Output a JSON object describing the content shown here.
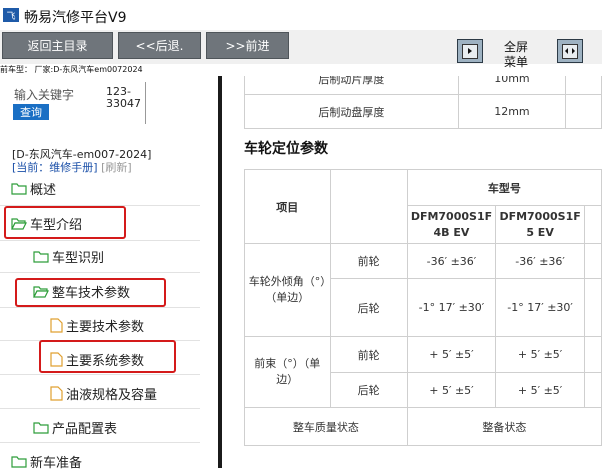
{
  "window": {
    "title": "畅易汽修平台V9"
  },
  "toolbar": {
    "back_main": "返回主目录",
    "back": "<<后退.",
    "forward": ">>前进",
    "fullscreen_line1": "全屏",
    "fullscreen_line2": "菜单"
  },
  "status": {
    "text": "前车型：  厂家:D-东风汽车em0072024"
  },
  "sidebar": {
    "keyword_label": "输入关键字",
    "keyword_value_line1": "123-",
    "keyword_value_line2": "33047",
    "query_button": "查询",
    "doc_code": "[D-东风汽车-em007-2024]",
    "current_label": "[当前：维修手册]",
    "refresh_label": "[刷新]",
    "tree": [
      {
        "label": "概述"
      },
      {
        "label": "车型介绍"
      },
      {
        "label": "车型识别"
      },
      {
        "label": "整车技术参数"
      },
      {
        "label": "主要技术参数"
      },
      {
        "label": "主要系统参数"
      },
      {
        "label": "油液规格及容量"
      },
      {
        "label": "产品配置表"
      },
      {
        "label": "新车准备"
      }
    ]
  },
  "content": {
    "top_rows": [
      {
        "label": "后制动片厚度",
        "value": "10mm"
      },
      {
        "label": "后制动盘厚度",
        "value": "12mm"
      }
    ],
    "section_title": "车轮定位参数",
    "table": {
      "item_header": "项目",
      "model_header": "车型号",
      "model1": "DFM7000S1F4B EV",
      "model2": "DFM7000S1F5 EV",
      "camber_label": "车轮外倾角（°）（单边）",
      "toe_label": "前束（°）（单边）",
      "front": "前轮",
      "rear": "后轮",
      "camber_front_1": "-36′ ±36′",
      "camber_front_2": "-36′ ±36′",
      "camber_rear_1": "-1° 17′ ±30′",
      "camber_rear_2": "-1° 17′ ±30′",
      "toe_front_1": "+ 5′ ±5′",
      "toe_front_2": "+ 5′ ±5′",
      "toe_rear_1": "+ 5′ ±5′",
      "toe_rear_2": "+ 5′ ±5′",
      "mass_label": "整车质量状态",
      "mass_value": "整备状态"
    }
  },
  "colors": {
    "toolbar_button": "#6f757b",
    "highlight": "#d41a1a",
    "query_button": "#1a6fc4"
  }
}
